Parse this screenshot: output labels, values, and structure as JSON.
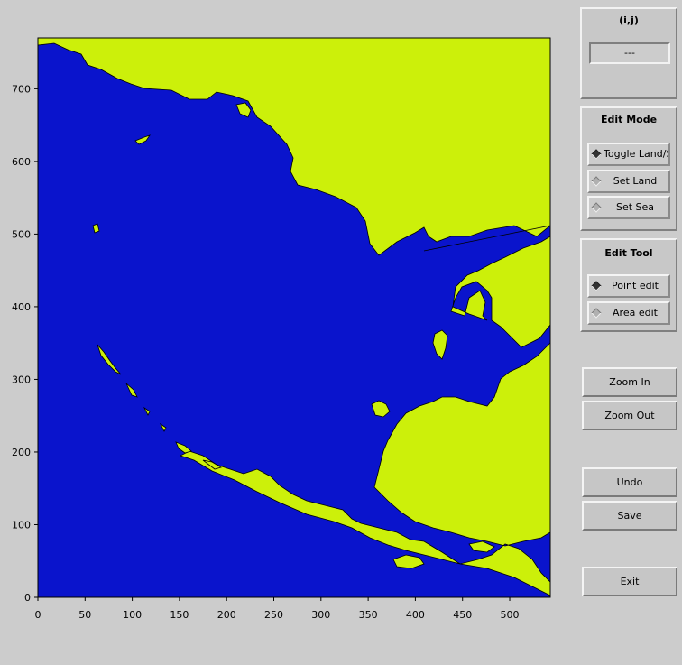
{
  "colors": {
    "sea": "#0a14cc",
    "land": "#ccf00a",
    "coast": "#000000"
  },
  "plot": {
    "xlim": [
      0,
      543
    ],
    "ylim": [
      0,
      770
    ],
    "x_ticks": [
      "0",
      "50",
      "100",
      "150",
      "200",
      "250",
      "300",
      "350",
      "400",
      "450",
      "500"
    ],
    "y_ticks": [
      "0",
      "100",
      "200",
      "300",
      "400",
      "500",
      "600",
      "700"
    ]
  },
  "ij_panel": {
    "title": "(i,j)",
    "value": "---"
  },
  "edit_mode": {
    "title": "Edit Mode",
    "options": [
      {
        "label": "Toggle Land/Sea",
        "selected": true
      },
      {
        "label": "Set Land",
        "selected": false
      },
      {
        "label": "Set Sea",
        "selected": false
      }
    ]
  },
  "edit_tool": {
    "title": "Edit Tool",
    "options": [
      {
        "label": "Point edit",
        "selected": true
      },
      {
        "label": "Area edit",
        "selected": false
      }
    ]
  },
  "buttons": {
    "zoom_in": "Zoom In",
    "zoom_out": "Zoom Out",
    "undo": "Undo",
    "save": "Save",
    "exit": "Exit"
  }
}
